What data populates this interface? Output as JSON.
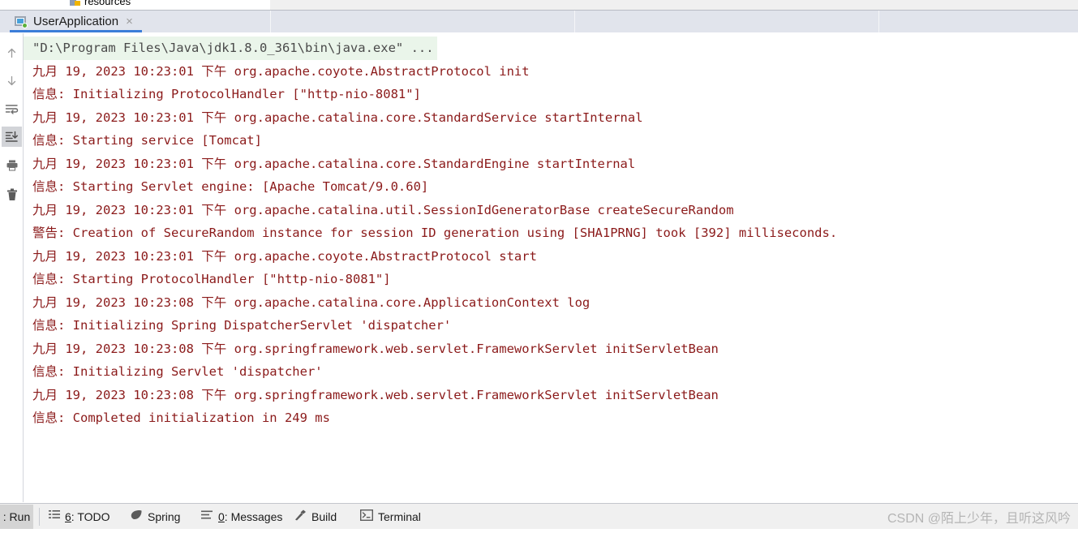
{
  "project_tree": {
    "visible_item": "resources",
    "icon": "folder-resources-icon"
  },
  "run_tool_window": {
    "tab": {
      "label": "UserApplication",
      "icon": "run-configuration-icon",
      "close_icon": "×",
      "running_indicator": "green-dot",
      "selected": true
    },
    "toolbar": [
      {
        "name": "up-arrow-icon",
        "title": "Up",
        "active": false
      },
      {
        "name": "down-arrow-icon",
        "title": "Down",
        "active": false
      },
      {
        "name": "soft-wrap-icon",
        "title": "Soft-Wrap",
        "active": false
      },
      {
        "name": "scroll-to-end-icon",
        "title": "Scroll to End",
        "active": true
      },
      {
        "name": "print-icon",
        "title": "Print",
        "active": false
      },
      {
        "name": "trash-icon",
        "title": "Clear All",
        "active": false
      }
    ]
  },
  "console": {
    "accent_command_color": "#4a4a4a",
    "command_background": "#eaf5ea",
    "log_color": "#8b1a1a",
    "command_line": "\"D:\\Program Files\\Java\\jdk1.8.0_361\\bin\\java.exe\" ...",
    "lines": [
      "九月 19, 2023 10:23:01 下午 org.apache.coyote.AbstractProtocol init",
      "信息: Initializing ProtocolHandler [\"http-nio-8081\"]",
      "九月 19, 2023 10:23:01 下午 org.apache.catalina.core.StandardService startInternal",
      "信息: Starting service [Tomcat]",
      "九月 19, 2023 10:23:01 下午 org.apache.catalina.core.StandardEngine startInternal",
      "信息: Starting Servlet engine: [Apache Tomcat/9.0.60]",
      "九月 19, 2023 10:23:01 下午 org.apache.catalina.util.SessionIdGeneratorBase createSecureRandom",
      "警告: Creation of SecureRandom instance for session ID generation using [SHA1PRNG] took [392] milliseconds.",
      "九月 19, 2023 10:23:01 下午 org.apache.coyote.AbstractProtocol start",
      "信息: Starting ProtocolHandler [\"http-nio-8081\"]",
      "九月 19, 2023 10:23:08 下午 org.apache.catalina.core.ApplicationContext log",
      "信息: Initializing Spring DispatcherServlet 'dispatcher'",
      "九月 19, 2023 10:23:08 下午 org.springframework.web.servlet.FrameworkServlet initServletBean",
      "信息: Initializing Servlet 'dispatcher'",
      "九月 19, 2023 10:23:08 下午 org.springframework.web.servlet.FrameworkServlet initServletBean",
      "信息: Completed initialization in 249 ms"
    ]
  },
  "statusbar": {
    "run_tab": ": Run",
    "items": [
      {
        "icon": "todo-list-icon",
        "number": "6",
        "label": ": TODO"
      },
      {
        "icon": "spring-leaf-icon",
        "number": "",
        "label": "Spring"
      },
      {
        "icon": "messages-icon",
        "number": "0",
        "label": ": Messages"
      },
      {
        "icon": "build-hammer-icon",
        "number": "",
        "label": "Build"
      },
      {
        "icon": "terminal-icon",
        "number": "",
        "label": "Terminal"
      }
    ],
    "watermark": "CSDN @陌上少年，且听这风吟"
  }
}
